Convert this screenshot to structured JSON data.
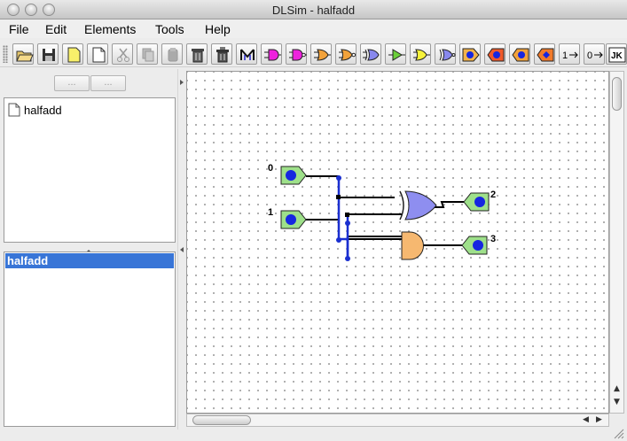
{
  "window": {
    "title": "DLSim - halfadd"
  },
  "menu": [
    "File",
    "Edit",
    "Elements",
    "Tools",
    "Help"
  ],
  "toolbar": {
    "buttons": [
      "open-file",
      "save",
      "new-document",
      "blank-document",
      "cut",
      "copy",
      "paste",
      "delete",
      "delete-all",
      "wire",
      "and-gate",
      "nand-gate",
      "or-gate",
      "nor-gate",
      "xor-gate",
      "buffer",
      "not-gate",
      "xnor-gate",
      "input-switch",
      "output-led",
      "input-clock",
      "output-display",
      "high-constant",
      "low-constant",
      "jk-flipflop"
    ],
    "labels": {
      "high": "1",
      "low": "0",
      "jk": "JK"
    }
  },
  "left_panel": {
    "nav_buttons": [
      "...",
      "..."
    ],
    "tree_item": "halfadd",
    "list_selected": "halfadd"
  },
  "circuit": {
    "input_labels": [
      "0",
      "1"
    ],
    "output_labels": [
      "2",
      "3"
    ],
    "colors": {
      "pin_fill": "#9ee08a",
      "pin_dot": "#1626e0",
      "wire_blue": "#1a2fd0",
      "or_gate": "#8e8ef0",
      "and_gate": "#f6b870"
    }
  }
}
